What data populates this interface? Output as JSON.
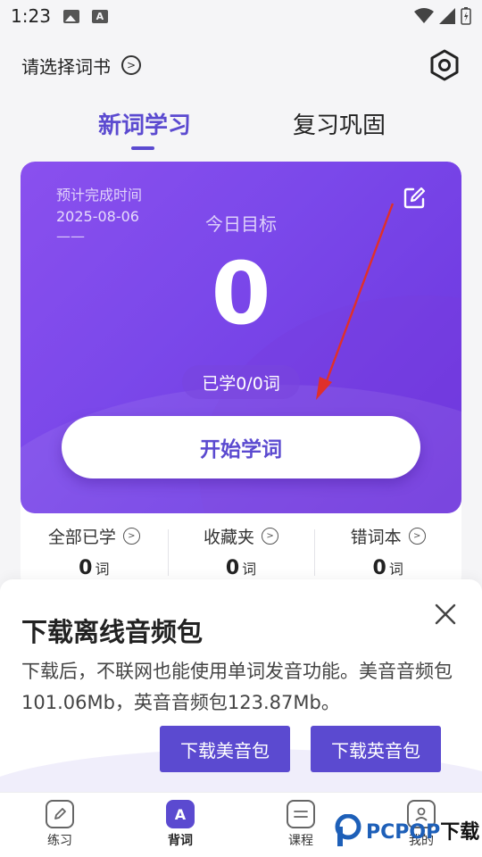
{
  "status_bar": {
    "time": "1:23"
  },
  "header": {
    "book_select_label": "请选择词书"
  },
  "tabs": [
    {
      "label": "新词学习",
      "active": true
    },
    {
      "label": "复习巩固",
      "active": false
    }
  ],
  "card": {
    "deadline_label": "预计完成时间",
    "deadline_date": "2025-08-06",
    "deadline_extra": "——",
    "goal_label": "今日目标",
    "goal_value": "0",
    "learned_text": "已学0/0词",
    "start_button": "开始学词"
  },
  "stats": [
    {
      "label": "全部已学",
      "value": "0",
      "unit": "词"
    },
    {
      "label": "收藏夹",
      "value": "0",
      "unit": "词"
    },
    {
      "label": "错词本",
      "value": "0",
      "unit": "词"
    }
  ],
  "sheet": {
    "title": "下载离线音频包",
    "description": "下载后，不联网也能使用单词发音功能。美音音频包101.06Mb，英音音频包123.87Mb。",
    "us_button": "下载美音包",
    "uk_button": "下载英音包"
  },
  "nav": [
    {
      "label": "练习",
      "icon": "pencil-icon",
      "active": false
    },
    {
      "label": "背词",
      "icon": "letter-a-icon",
      "active": true
    },
    {
      "label": "课程",
      "icon": "course-icon",
      "active": false
    },
    {
      "label": "我的",
      "icon": "profile-icon",
      "active": false
    }
  ],
  "watermark": {
    "brand": "PCPOP",
    "suffix": "下载"
  },
  "colors": {
    "accent": "#5b4ad0",
    "card_gradient_start": "#8a50ee",
    "card_gradient_end": "#6a34dd",
    "annotation": "#e0302a"
  }
}
